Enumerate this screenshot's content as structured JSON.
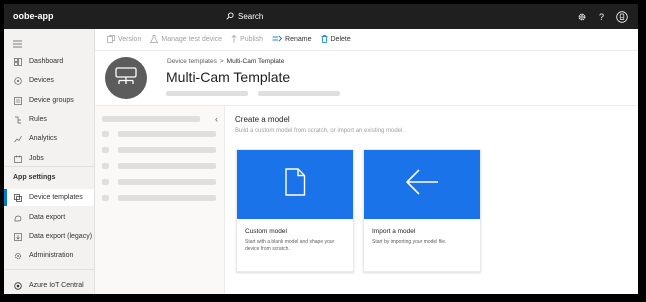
{
  "topbar": {
    "app_name": "oobe-app",
    "search_label": "Search",
    "icons": [
      "settings-icon",
      "help-icon",
      "account-icon"
    ]
  },
  "sidebar": {
    "items": [
      {
        "label": "Dashboard",
        "icon": "dashboard-icon"
      },
      {
        "label": "Devices",
        "icon": "devices-icon"
      },
      {
        "label": "Device groups",
        "icon": "device-groups-icon"
      },
      {
        "label": "Rules",
        "icon": "rules-icon"
      },
      {
        "label": "Analytics",
        "icon": "analytics-icon"
      },
      {
        "label": "Jobs",
        "icon": "jobs-icon"
      }
    ],
    "section_label": "App settings",
    "settings_items": [
      {
        "label": "Device templates",
        "icon": "device-templates-icon",
        "active": true
      },
      {
        "label": "Data export",
        "icon": "data-export-icon"
      },
      {
        "label": "Data export (legacy)",
        "icon": "data-export-legacy-icon"
      },
      {
        "label": "Administration",
        "icon": "administration-icon"
      }
    ],
    "footer_item": {
      "label": "Azure IoT Central",
      "icon": "iot-central-icon"
    }
  },
  "commandbar": {
    "version": "Version",
    "manage_test_device": "Manage test device",
    "publish": "Publish",
    "rename": "Rename",
    "delete": "Delete"
  },
  "header": {
    "breadcrumb_parent": "Device templates",
    "breadcrumb_separator": ">",
    "breadcrumb_current": "Multi-Cam Template",
    "title": "Multi-Cam Template"
  },
  "create_model": {
    "title": "Create a model",
    "subtitle": "Build a custom model from scratch, or import an existing model.",
    "cards": [
      {
        "title": "Custom model",
        "description": "Start with a blank model and shape your device from scratch.",
        "icon": "blank-document-icon"
      },
      {
        "title": "Import a model",
        "description": "Start by importing your model file.",
        "icon": "arrow-left-icon"
      }
    ]
  },
  "colors": {
    "accent": "#0078d4",
    "card_hero": "#1a73e8",
    "topbar": "#1f1f1f"
  }
}
